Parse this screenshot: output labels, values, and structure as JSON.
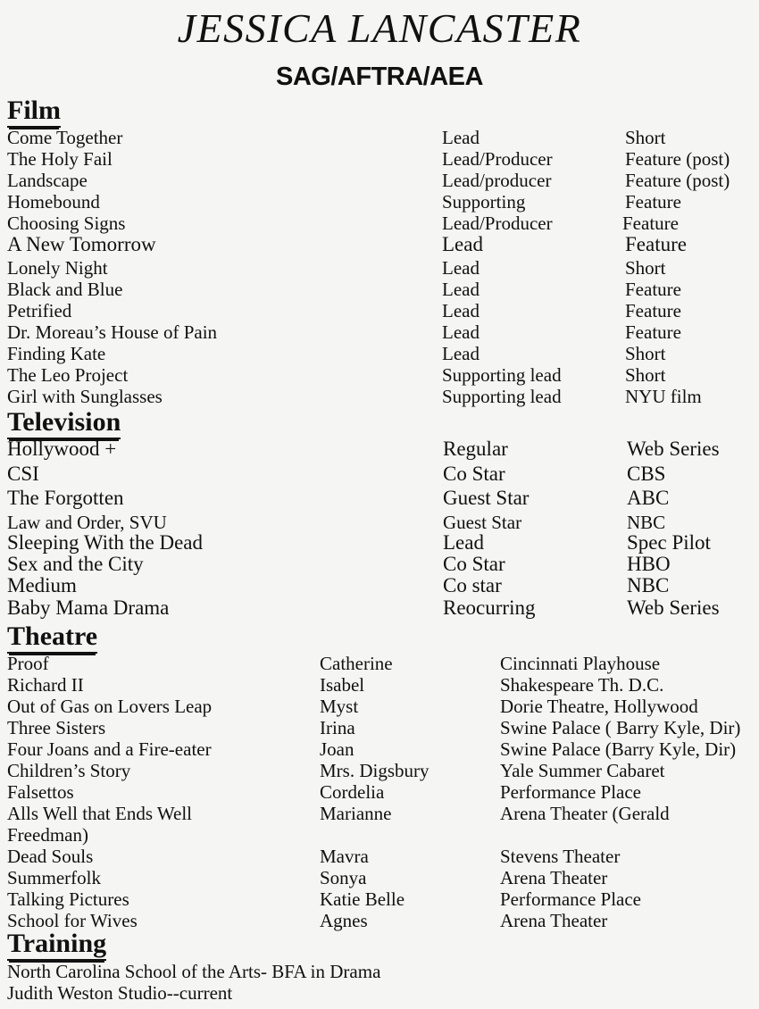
{
  "header": {
    "name": "JESSICA LANCASTER",
    "unions": "SAG/AFTRA/AEA"
  },
  "sections": {
    "film": {
      "heading": "Film",
      "credits": [
        {
          "title": "Come Together",
          "role": "Lead",
          "type": "Short"
        },
        {
          "title": "The Holy Fail",
          "role": "Lead/Producer",
          "type": "Feature (post)"
        },
        {
          "title": "Landscape",
          "role": "Lead/producer",
          "type": "Feature (post)"
        },
        {
          "title": "Homebound",
          "role": "Supporting",
          "type": "Feature"
        },
        {
          "title": "Choosing Signs",
          "role": "Lead/Producer",
          "type": "Feature"
        },
        {
          "title": "A New Tomorrow",
          "role": "Lead",
          "type": "Feature"
        },
        {
          "title": "Lonely Night",
          "role": "Lead",
          "type": "Short"
        },
        {
          "title": "Black and Blue",
          "role": "Lead",
          "type": "Feature"
        },
        {
          "title": " Petrified",
          "role": "Lead",
          "type": "Feature"
        },
        {
          "title": "Dr. Moreau’s House of Pain",
          "role": "Lead",
          "type": "Feature"
        },
        {
          "title": "Finding Kate",
          "role": "Lead",
          "type": "Short"
        },
        {
          "title": "The Leo Project",
          "role": "Supporting lead",
          "type": "Short"
        },
        {
          "title": "Girl with Sunglasses",
          "role": "Supporting lead",
          "type": "NYU film"
        }
      ]
    },
    "television": {
      "heading": "Television",
      "credits": [
        {
          "title": "Hollywood +",
          "role": "Regular",
          "type": "Web Series"
        },
        {
          "title": "CSI",
          "role": "Co Star",
          "type": "CBS"
        },
        {
          "title": "The Forgotten",
          "role": "Guest Star",
          "type": "ABC"
        },
        {
          "title": "Law and Order, SVU",
          "role": "Guest Star",
          "type": "NBC"
        },
        {
          "title": "Sleeping With the Dead",
          "role": "Lead",
          "type": "Spec Pilot"
        },
        {
          "title": "Sex and the City",
          "role": "Co Star",
          "type": "HBO"
        },
        {
          "title": "Medium",
          "role": "Co star",
          "type": "NBC"
        },
        {
          "title": "Baby Mama Drama",
          "role": "Reocurring",
          "type": "Web Series"
        }
      ]
    },
    "theatre": {
      "heading": "Theatre",
      "credits": [
        {
          "title": "Proof",
          "role": "Catherine",
          "venue": "Cincinnati Playhouse"
        },
        {
          "title": "Richard II",
          "role": "Isabel",
          "venue": "Shakespeare Th. D.C."
        },
        {
          "title": "Out of Gas on Lovers Leap",
          "role": "Myst",
          "venue": "Dorie Theatre, Hollywood"
        },
        {
          "title": "Three Sisters",
          "role": "Irina",
          "venue": "Swine Palace ( Barry Kyle, Dir)"
        },
        {
          "title": "Four Joans and a Fire-eater",
          "role": "Joan",
          "venue": "Swine Palace (Barry Kyle, Dir)"
        },
        {
          "title": "Children’s Story",
          "role": "Mrs. Digsbury",
          "venue": "Yale Summer Cabaret"
        },
        {
          "title": "Falsettos",
          "role": "Cordelia",
          "venue": "Performance Place"
        },
        {
          "title": "Alls Well that Ends Well",
          "role": "Marianne",
          "venue": "Arena Theater (Gerald"
        },
        {
          "title": "Dead Souls",
          "role": "Mavra",
          "venue": "Stevens Theater"
        },
        {
          "title": "Summerfolk",
          "role": "Sonya",
          "venue": "Arena Theater"
        },
        {
          "title": "Talking Pictures",
          "role": "Katie Belle",
          "venue": "Performance Place"
        },
        {
          "title": "School for Wives",
          "role": "Agnes",
          "venue": "Arena Theater"
        }
      ],
      "wrap_continuation": "Freedman)"
    },
    "training": {
      "heading": "Training",
      "lines": [
        "North Carolina School of the Arts- BFA in Drama",
        "Judith Weston Studio--current"
      ]
    }
  }
}
